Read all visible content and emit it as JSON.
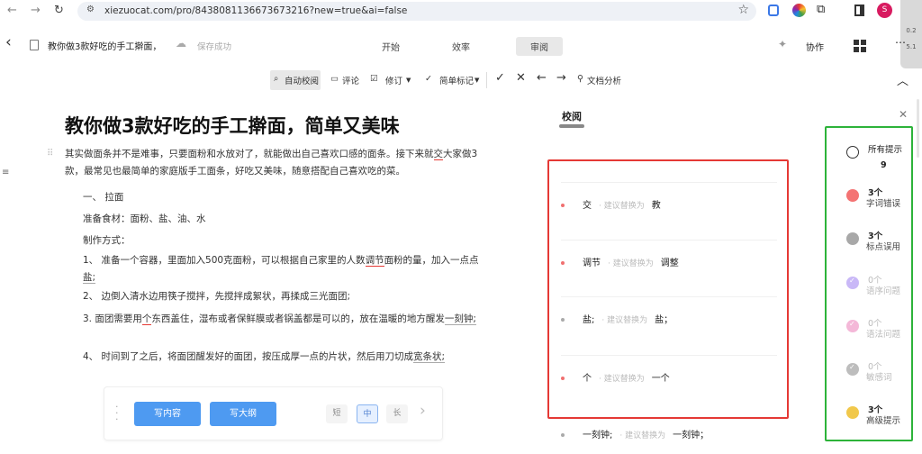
{
  "browser": {
    "url": "xiezuocat.com/pro/8438081136673673216?new=true&ai=false",
    "avatar": "S",
    "ext_speed_up": "0.2",
    "ext_speed_down": "5.1"
  },
  "header": {
    "doc_name": "教你做3款好吃的手工擀面，",
    "save_status": "保存成功",
    "tabs": [
      {
        "label": "开始"
      },
      {
        "label": "效率"
      },
      {
        "label": "审阅"
      }
    ],
    "collab": "协作"
  },
  "toolbar": {
    "auto_check": "自动校阅",
    "comment": "评论",
    "revise": "修订",
    "mark": "简单标记",
    "analysis": "文档分析"
  },
  "doc": {
    "title": "教你做3款好吃的手工擀面，简单又美味",
    "paragraphs": [
      {
        "indent": false,
        "segs": [
          {
            "t": "其实做面条并不是难事，只要面粉和水放对了，就能做出自己喜欢口感的面条。接下来就"
          },
          {
            "t": "交",
            "m": "red"
          },
          {
            "t": "大家做3款，最常见也最简单的家庭版手工面条，好吃又美味，随意搭配自己喜欢吃的菜。"
          }
        ]
      },
      {
        "indent": true,
        "segs": [
          {
            "t": "一、 拉面"
          }
        ]
      },
      {
        "indent": true,
        "segs": [
          {
            "t": "准备食材：面粉、盐、油、水"
          }
        ]
      },
      {
        "indent": true,
        "segs": [
          {
            "t": "制作方式："
          }
        ]
      },
      {
        "indent": true,
        "segs": [
          {
            "t": "1、 准备一个容器，里面加入500克面粉，可以根据自己家里的人数"
          },
          {
            "t": "调节",
            "m": "red"
          },
          {
            "t": "面粉的量，加入一点点"
          },
          {
            "t": "盐;",
            "m": "gray"
          }
        ]
      },
      {
        "indent": true,
        "segs": [
          {
            "t": "2、 边倒入清水边用筷子搅拌，先搅拌成絮状，再揉成三光面团;"
          }
        ]
      },
      {
        "indent": true,
        "segs": [
          {
            "t": "3. 面团需要用"
          },
          {
            "t": "个",
            "m": "red"
          },
          {
            "t": "东西盖住，湿布或者保鲜膜或者锅盖都是可以的，放在温暖的地方醒发"
          },
          {
            "t": "一刻钟;",
            "m": "gray"
          }
        ]
      },
      {
        "indent": true,
        "segs": [
          {
            "t": "4、 时间到了之后，将面团醒发好的面团，按压成厚一点的片状，然后用刀切成"
          },
          {
            "t": "宽条状;",
            "m": "gray"
          }
        ]
      }
    ]
  },
  "writebar": {
    "write_content": "写内容",
    "write_outline": "写大纲",
    "lengths": [
      "短",
      "中",
      "长"
    ]
  },
  "panel": {
    "title": "校阅",
    "hint": "· 建议替换为",
    "suggestions": [
      {
        "from": "交",
        "to": "教",
        "color": "#f07070"
      },
      {
        "from": "调节",
        "to": "调整",
        "color": "#f07070"
      },
      {
        "from": "盐;",
        "to": "盐；",
        "color": "#aaaaaa"
      },
      {
        "from": "个",
        "to": "一个",
        "color": "#f07070"
      },
      {
        "from": "一刻钟;",
        "to": "一刻钟；",
        "color": "#aaaaaa"
      }
    ],
    "categories": [
      {
        "count": "所有提示",
        "label": "9",
        "color": "#ffffff"
      },
      {
        "count": "3个",
        "label": "字词错误",
        "color": "#f47373"
      },
      {
        "count": "3个",
        "label": "标点误用",
        "color": "#a8a8a8"
      },
      {
        "count": "0个",
        "label": "语序问题",
        "color": "#c9b8f7"
      },
      {
        "count": "0个",
        "label": "语法问题",
        "color": "#f4b8d8"
      },
      {
        "count": "0个",
        "label": "敏感词",
        "color": "#bdbdbd"
      },
      {
        "count": "3个",
        "label": "高级提示",
        "color": "#f1c84b"
      }
    ]
  }
}
